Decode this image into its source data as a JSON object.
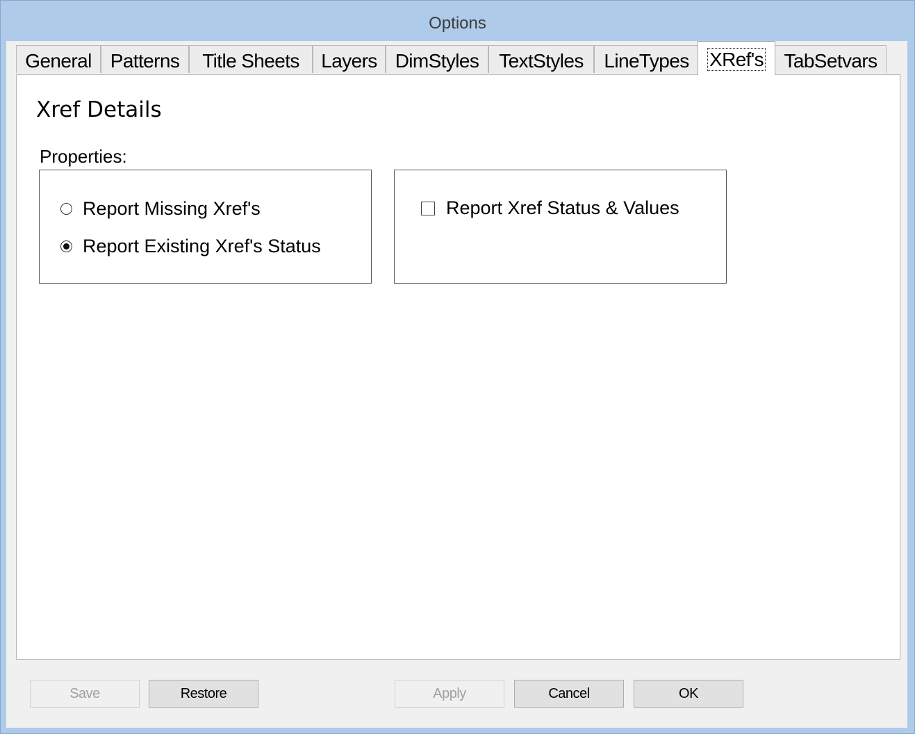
{
  "window": {
    "title": "Options"
  },
  "tabs": [
    {
      "label": "General",
      "active": false
    },
    {
      "label": "Patterns",
      "active": false
    },
    {
      "label": "Title Sheets",
      "active": false
    },
    {
      "label": "Layers",
      "active": false
    },
    {
      "label": "DimStyles",
      "active": false
    },
    {
      "label": "TextStyles",
      "active": false
    },
    {
      "label": "LineTypes",
      "active": false
    },
    {
      "label": "XRef's",
      "active": true
    },
    {
      "label": "TabSetvars",
      "active": false
    }
  ],
  "page": {
    "heading": "Xref Details",
    "properties_label": "Properties:",
    "radio_group": [
      {
        "label": "Report Missing Xref's",
        "checked": false
      },
      {
        "label": "Report Existing Xref's Status",
        "checked": true
      }
    ],
    "checkbox": {
      "label": "Report Xref Status & Values",
      "checked": false
    }
  },
  "buttons": {
    "save": {
      "label": "Save",
      "enabled": false
    },
    "restore": {
      "label": "Restore",
      "enabled": true
    },
    "apply": {
      "label": "Apply",
      "enabled": false
    },
    "cancel": {
      "label": "Cancel",
      "enabled": true
    },
    "ok": {
      "label": "OK",
      "enabled": true
    }
  },
  "colors": {
    "frame": "#aecbe9",
    "dialog_bg": "#f0f0f0",
    "tab_page_bg": "#ffffff"
  }
}
